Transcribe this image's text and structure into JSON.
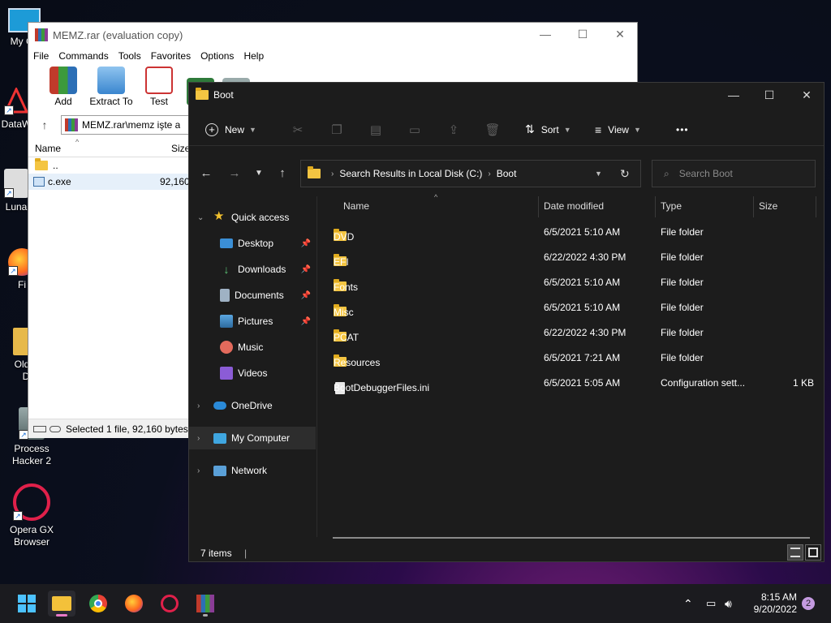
{
  "desktop": {
    "icons": [
      {
        "label": "My Co",
        "icon": "computer-icon"
      },
      {
        "label": "DataW",
        "icon": "datawrapper-icon"
      },
      {
        "label": "Luna",
        "icon": "luna-icon"
      },
      {
        "label": "Fi",
        "icon": "firefox-icon"
      },
      {
        "label": "Old",
        "icon": "folder-icon"
      },
      {
        "label": "D",
        "icon": "folder-icon"
      },
      {
        "label": "Process Hacker 2",
        "icon": "process-hacker-icon"
      },
      {
        "label": "Opera GX Browser",
        "icon": "opera-gx-icon"
      }
    ]
  },
  "winrar": {
    "title": "MEMZ.rar (evaluation copy)",
    "menu": [
      "File",
      "Commands",
      "Tools",
      "Favorites",
      "Options",
      "Help"
    ],
    "toolbar": [
      {
        "label": "Add",
        "icon": "add-archive-icon"
      },
      {
        "label": "Extract To",
        "icon": "extract-icon"
      },
      {
        "label": "Test",
        "icon": "test-icon"
      }
    ],
    "path": "MEMZ.rar\\memz işte a",
    "columns": {
      "name": "Name",
      "size": "Size"
    },
    "files": [
      {
        "name": "..",
        "size": ""
      },
      {
        "name": "c.exe",
        "size": "92,160"
      }
    ],
    "status": "Selected 1 file, 92,160 bytes"
  },
  "explorer": {
    "title": "Boot",
    "commands": {
      "new": "New",
      "sort": "Sort",
      "view": "View",
      "more": "•••"
    },
    "breadcrumb": [
      "Search Results in Local Disk (C:)",
      "Boot"
    ],
    "search_placeholder": "Search Boot",
    "nav": {
      "quick_access": "Quick access",
      "items": [
        "Desktop",
        "Downloads",
        "Documents",
        "Pictures",
        "Music",
        "Videos"
      ],
      "onedrive": "OneDrive",
      "my_computer": "My Computer",
      "network": "Network"
    },
    "columns": {
      "name": "Name",
      "date": "Date modified",
      "type": "Type",
      "size": "Size"
    },
    "rows": [
      {
        "name": "DVD",
        "date": "6/5/2021 5:10 AM",
        "type": "File folder",
        "size": ""
      },
      {
        "name": "EFI",
        "date": "6/22/2022 4:30 PM",
        "type": "File folder",
        "size": ""
      },
      {
        "name": "Fonts",
        "date": "6/5/2021 5:10 AM",
        "type": "File folder",
        "size": ""
      },
      {
        "name": "Misc",
        "date": "6/5/2021 5:10 AM",
        "type": "File folder",
        "size": ""
      },
      {
        "name": "PCAT",
        "date": "6/22/2022 4:30 PM",
        "type": "File folder",
        "size": ""
      },
      {
        "name": "Resources",
        "date": "6/5/2021 7:21 AM",
        "type": "File folder",
        "size": ""
      },
      {
        "name": "BootDebuggerFiles.ini",
        "date": "6/5/2021 5:05 AM",
        "type": "Configuration sett...",
        "size": "1 KB"
      }
    ],
    "status": "7 items"
  },
  "taskbar": {
    "time": "8:15 AM",
    "date": "9/20/2022",
    "notifications": "2"
  }
}
